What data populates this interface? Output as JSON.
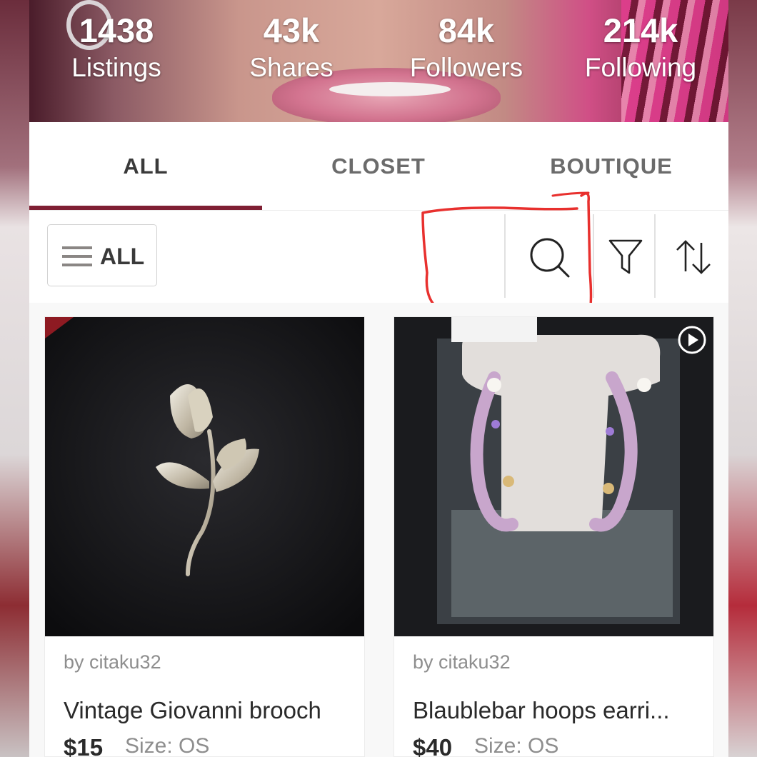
{
  "profile_stats": [
    {
      "value": "1438",
      "label": "Listings"
    },
    {
      "value": "43k",
      "label": "Shares"
    },
    {
      "value": "84k",
      "label": "Followers"
    },
    {
      "value": "214k",
      "label": "Following"
    }
  ],
  "tabs": [
    {
      "label": "ALL",
      "active": true
    },
    {
      "label": "CLOSET",
      "active": false
    },
    {
      "label": "BOUTIQUE",
      "active": false
    }
  ],
  "toolbar": {
    "filter_label": "ALL",
    "icons": [
      "search-icon",
      "filter-funnel-icon",
      "sort-arrows-icon"
    ]
  },
  "listings": [
    {
      "seller": "by citaku32",
      "title": "Vintage Giovanni brooch",
      "price": "$15",
      "size": "Size: OS",
      "has_video": false
    },
    {
      "seller": "by citaku32",
      "title": "Blaublebar hoops earri...",
      "price": "$40",
      "size": "Size: OS",
      "has_video": true
    }
  ],
  "colors": {
    "accent": "#7f1f33",
    "annotation": "#e8302e"
  }
}
